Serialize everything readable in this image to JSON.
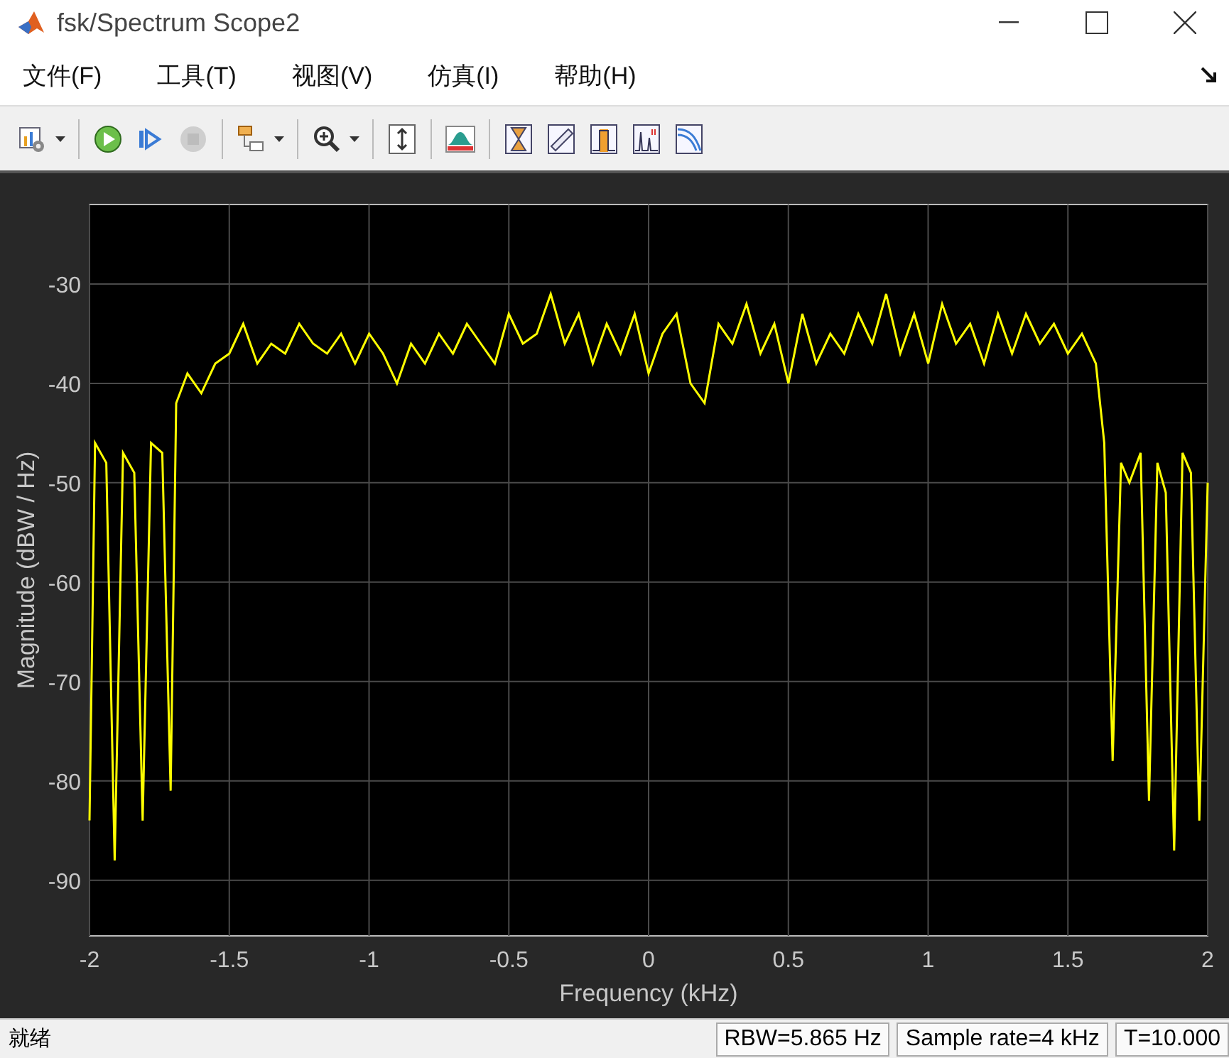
{
  "window": {
    "title": "fsk/Spectrum Scope2"
  },
  "menu": [
    {
      "label": "文件(F)"
    },
    {
      "label": "工具(T)"
    },
    {
      "label": "视图(V)"
    },
    {
      "label": "仿真(I)"
    },
    {
      "label": "帮助(H)"
    }
  ],
  "toolbar": [
    {
      "kind": "settings",
      "dropdown": true
    },
    {
      "kind": "sep"
    },
    {
      "kind": "run"
    },
    {
      "kind": "step"
    },
    {
      "kind": "stop",
      "disabled": true
    },
    {
      "kind": "sep"
    },
    {
      "kind": "blocks",
      "dropdown": true
    },
    {
      "kind": "sep"
    },
    {
      "kind": "zoom",
      "dropdown": true
    },
    {
      "kind": "sep"
    },
    {
      "kind": "scale"
    },
    {
      "kind": "sep"
    },
    {
      "kind": "style"
    },
    {
      "kind": "sep"
    },
    {
      "kind": "cursor"
    },
    {
      "kind": "ruler"
    },
    {
      "kind": "peak"
    },
    {
      "kind": "distortion"
    },
    {
      "kind": "ccdf"
    }
  ],
  "plot": {
    "chart_data": {
      "type": "line",
      "xlabel": "Frequency (kHz)",
      "ylabel": "Magnitude (dBW / Hz)",
      "xlim": [
        -2,
        2
      ],
      "ylim": [
        -95.6,
        -22
      ],
      "xticks": [
        {
          "value": -2,
          "label": "-2"
        },
        {
          "value": -1.5,
          "label": "-1.5"
        },
        {
          "value": -1,
          "label": "-1"
        },
        {
          "value": -0.5,
          "label": "-0.5"
        },
        {
          "value": 0,
          "label": "0"
        },
        {
          "value": 0.5,
          "label": "0.5"
        },
        {
          "value": 1,
          "label": "1"
        },
        {
          "value": 1.5,
          "label": "1.5"
        },
        {
          "value": 2,
          "label": "2"
        }
      ],
      "yticks": [
        {
          "value": -90,
          "label": "-90"
        },
        {
          "value": -80,
          "label": "-80"
        },
        {
          "value": -70,
          "label": "-70"
        },
        {
          "value": -60,
          "label": "-60"
        },
        {
          "value": -50,
          "label": "-50"
        },
        {
          "value": -40,
          "label": "-40"
        },
        {
          "value": -30,
          "label": "-30"
        }
      ],
      "x": [
        -2,
        -1.98,
        -1.94,
        -1.91,
        -1.88,
        -1.84,
        -1.81,
        -1.78,
        -1.74,
        -1.71,
        -1.69,
        -1.65,
        -1.6,
        -1.55,
        -1.5,
        -1.45,
        -1.4,
        -1.35,
        -1.3,
        -1.25,
        -1.2,
        -1.15,
        -1.1,
        -1.05,
        -1,
        -0.95,
        -0.9,
        -0.85,
        -0.8,
        -0.75,
        -0.7,
        -0.65,
        -0.6,
        -0.55,
        -0.5,
        -0.45,
        -0.4,
        -0.35,
        -0.3,
        -0.25,
        -0.2,
        -0.15,
        -0.1,
        -0.05,
        0,
        0.05,
        0.1,
        0.15,
        0.2,
        0.25,
        0.3,
        0.35,
        0.4,
        0.45,
        0.5,
        0.55,
        0.6,
        0.65,
        0.7,
        0.75,
        0.8,
        0.85,
        0.9,
        0.95,
        1,
        1.05,
        1.1,
        1.15,
        1.2,
        1.25,
        1.3,
        1.35,
        1.4,
        1.45,
        1.5,
        1.55,
        1.6,
        1.63,
        1.66,
        1.69,
        1.72,
        1.76,
        1.79,
        1.82,
        1.85,
        1.88,
        1.91,
        1.94,
        1.97,
        2
      ],
      "grid": true,
      "series": [
        {
          "color": "#ffff00",
          "values": [
            -84,
            -46,
            -48,
            -88,
            -47,
            -49,
            -84,
            -46,
            -47,
            -81,
            -42,
            -39,
            -41,
            -38,
            -37,
            -34,
            -38,
            -36,
            -37,
            -34,
            -36,
            -37,
            -35,
            -38,
            -35,
            -37,
            -40,
            -36,
            -38,
            -35,
            -37,
            -34,
            -36,
            -38,
            -33,
            -36,
            -35,
            -31,
            -36,
            -33,
            -38,
            -34,
            -37,
            -33,
            -39,
            -35,
            -33,
            -40,
            -42,
            -34,
            -36,
            -32,
            -37,
            -34,
            -40,
            -33,
            -38,
            -35,
            -37,
            -33,
            -36,
            -31,
            -37,
            -33,
            -38,
            -32,
            -36,
            -34,
            -38,
            -33,
            -37,
            -33,
            -36,
            -34,
            -37,
            -35,
            -38,
            -46,
            -78,
            -48,
            -50,
            -47,
            -82,
            -48,
            -51,
            -87,
            -47,
            -49,
            -84,
            -50
          ]
        }
      ]
    }
  },
  "status_bar": {
    "message": "就绪",
    "panels": [
      "RBW=5.865 Hz",
      "Sample rate=4 kHz",
      "T=10.000"
    ]
  }
}
